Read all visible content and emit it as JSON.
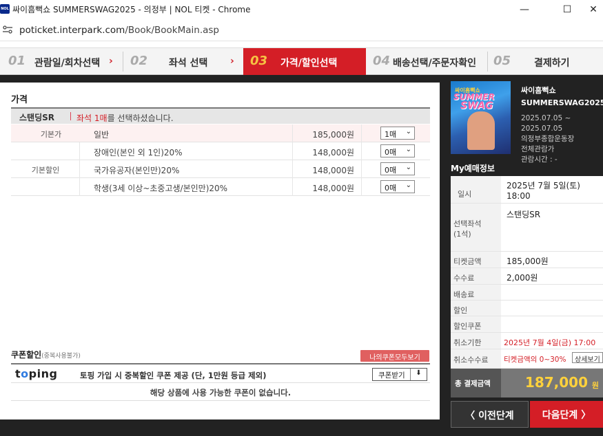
{
  "window": {
    "favicon_text": "NOL",
    "title": "싸이흠뻑쇼 SUMMERSWAG2025 - 의정부 | NOL 티켓 - Chrome",
    "minimize": "—",
    "maximize": "☐",
    "close": "✕"
  },
  "address": {
    "host": "poticket.interpark.com",
    "path": "/Book/BookMain.asp"
  },
  "steps": [
    {
      "num": "01",
      "label": "관람일/회차선택"
    },
    {
      "num": "02",
      "label": "좌석 선택"
    },
    {
      "num": "03",
      "label": "가격/할인선택"
    },
    {
      "num": "04",
      "label": "배송선택/주문자확인"
    },
    {
      "num": "05",
      "label": "결제하기"
    }
  ],
  "price": {
    "title": "가격",
    "seat_grade": "스탠딩SR",
    "seat_msg_prefix": "좌석 1매",
    "seat_msg_suffix": "를 선택하셨습니다.",
    "category_basic": "기본가",
    "category_discount": "기본할인",
    "rows": [
      {
        "name": "일반",
        "price": "185,000원",
        "qty": "1매"
      },
      {
        "name": "장애인(본인 외 1인)20%",
        "price": "148,000원",
        "qty": "0매"
      },
      {
        "name": "국가유공자(본인만)20%",
        "price": "148,000원",
        "qty": "0매"
      },
      {
        "name": "학생(3세 이상~초중고생/본인만)20%",
        "price": "148,000원",
        "qty": "0매"
      }
    ]
  },
  "coupon": {
    "title": "쿠폰할인",
    "note": "(중복사용불가)",
    "my_coupons": "나의쿠폰모두보기",
    "logo_pre": "t",
    "logo_o": "o",
    "logo_post": "ping",
    "description": "토핑 가입 시 중복할인 쿠폰 제공 (단, 1만원 등급 제외)",
    "get_button": "쿠폰받기",
    "none_message": "해당 상품에 사용 가능한 쿠폰이 없습니다."
  },
  "show": {
    "poster_line1": "싸이흠뻑쇼",
    "poster_line2": "SUMMER",
    "poster_line3": "SWAG",
    "title_line1": "싸이흠뻑쇼",
    "title_line2": "SUMMERSWAG2025",
    "date_start": "2025.07.05 ~",
    "date_end": "2025.07.05",
    "venue": "의정부종합운동장",
    "rating": "전체관람가",
    "runtime": "관람시간 : -"
  },
  "my_booking": {
    "title": "My예매정보",
    "rows": {
      "datetime_label": "일시",
      "datetime_value1": "2025년 7월 5일(토)",
      "datetime_value2": "18:00",
      "seat_label1": "선택좌석",
      "seat_label2": "(1석)",
      "seat_value": "스탠딩SR",
      "ticket_label": "티켓금액",
      "ticket_value": "185,000원",
      "fee_label": "수수료",
      "fee_value": "2,000원",
      "delivery_label": "배송료",
      "discount_label": "할인",
      "discount_coupon_label": "할인쿠폰",
      "cancel_deadline_label": "취소기한",
      "cancel_deadline_value": "2025년 7월 4일(금) 17:00",
      "cancel_fee_label": "취소수수료",
      "cancel_fee_value": "티켓금액의 0~30%",
      "detail_button": "상세보기"
    },
    "total_label": "총 결제금액",
    "total_amount": "187,000",
    "total_unit": "원"
  },
  "nav": {
    "prev": "이전단계",
    "next": "다음단계"
  },
  "colors": {
    "accent": "#d41e26",
    "total": "#ffd13c"
  }
}
